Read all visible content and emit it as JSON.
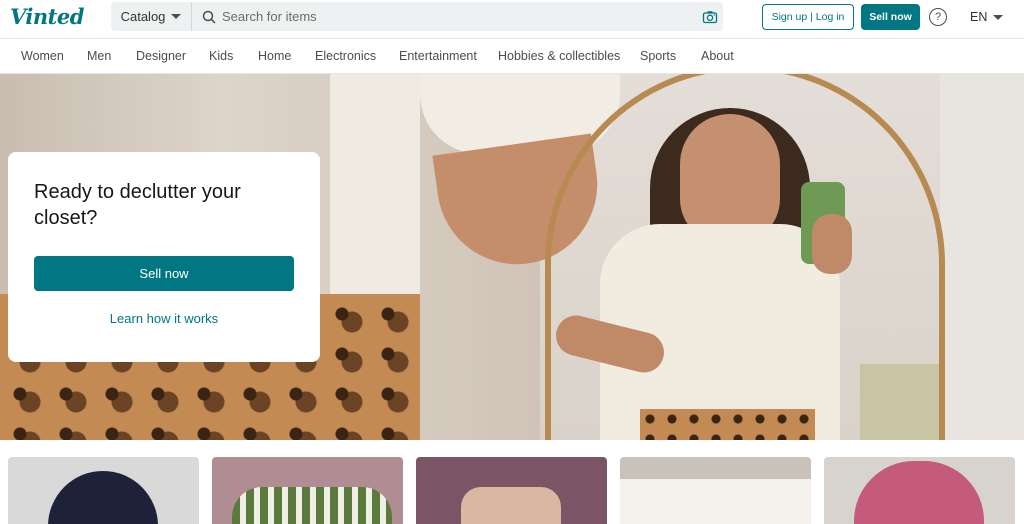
{
  "header": {
    "logo": "Vinted",
    "catalog_label": "Catalog",
    "search_placeholder": "Search for items",
    "signup_label": "Sign up | Log in",
    "sell_label": "Sell now",
    "help_label": "?",
    "language": "EN"
  },
  "nav": {
    "items": [
      "Women",
      "Men",
      "Designer",
      "Kids",
      "Home",
      "Electronics",
      "Entertainment",
      "Hobbies & collectibles",
      "Sports",
      "About"
    ]
  },
  "hero": {
    "title": "Ready to declutter your closet?",
    "sell_button": "Sell now",
    "learn_link": "Learn how it works"
  },
  "icons": {
    "search": "search-icon",
    "camera": "camera-icon",
    "help": "help-icon",
    "catalog_caret": "chevron-down-icon",
    "language_caret": "chevron-down-icon"
  },
  "colors": {
    "brand": "#007782",
    "text": "#171717",
    "muted": "#4d4d4d",
    "search_bg": "#eef1f1"
  },
  "item_thumbnails": [
    {
      "name": "item-thumbnail-1",
      "bg": "#d9d9d9",
      "accent": "#1e2238"
    },
    {
      "name": "item-thumbnail-2",
      "bg": "#b08c93",
      "accent": "#5d7a3e"
    },
    {
      "name": "item-thumbnail-3",
      "bg": "#7b5566",
      "accent": "#d9b7a3"
    },
    {
      "name": "item-thumbnail-4",
      "bg": "#c9c2ba",
      "accent": "#f4f1ec"
    },
    {
      "name": "item-thumbnail-5",
      "bg": "#d7d3cd",
      "accent": "#c45b7c"
    }
  ]
}
